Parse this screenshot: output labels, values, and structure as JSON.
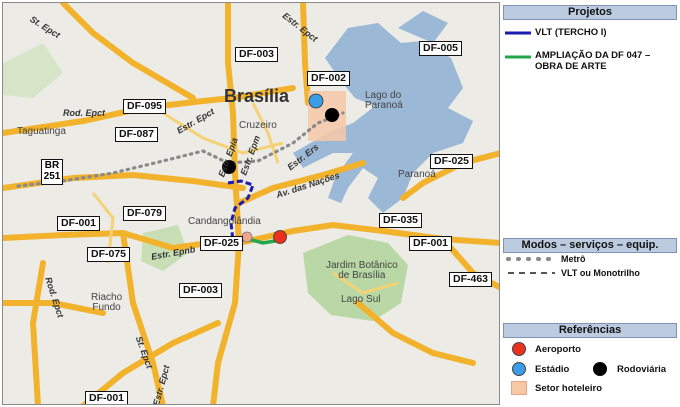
{
  "map": {
    "places": {
      "brasilia": "Brasília",
      "cruzeiro": "Cruzeiro",
      "lago_do_paranoa": "Lago do\nParanoá",
      "paranoa": "Paranoá",
      "taguatinga": "Taguatinga",
      "candangolandia": "Candangolândia",
      "jardim_botanico": "Jardim Botânico\nde Brasília",
      "lago_sul": "Lago Sul",
      "riacho_fundo": "Riacho\nFundo"
    },
    "roads": {
      "st_epct_top": "St. Epct",
      "estr_epct": "Estr. Epct",
      "rod_epct": "Rod. Epct",
      "estr_epct_mid": "Estr. Epct",
      "estr_epia": "Estr. Epia",
      "estr_epm": "Estr. Epm",
      "estr_ers": "Estr. Ers",
      "av_nacoes": "Av. das Nações",
      "estr_epnb": "Estr. Epnb",
      "rod_epct_left": "Rod. Epct",
      "st_epct_bottom": "St. Epct",
      "estr_epct_bottom": "Estr. Epct"
    },
    "shields": {
      "df003_top": "DF-003",
      "df005": "DF-005",
      "df002": "DF-002",
      "df095": "DF-095",
      "df087": "DF-087",
      "df025_right": "DF-025",
      "df079": "DF-079",
      "df001_left": "DF-001",
      "df035": "DF-035",
      "df025_bottom": "DF-025",
      "df001_right": "DF-001",
      "df075": "DF-075",
      "df463": "DF-463",
      "df003_bottom": "DF-003",
      "df001_bottom": "DF-001",
      "br251_top": "BR",
      "br251_bottom": "251"
    }
  },
  "legend": {
    "projetos": {
      "title": "Projetos",
      "vlt_label": "VLT  (TERCHO I)",
      "vlt_color": "#1b1bb0",
      "ampliacao_label": "AMPLIAÇÃO DA DF 047 –\nOBRA DE ARTE",
      "ampliacao_color": "#22a84a"
    },
    "modos": {
      "title": "Modos – serviços – equip.",
      "metro_label": "Metrô",
      "vlt_mono_label": "VLT ou Monotrilho"
    },
    "referencias": {
      "title": "Referências",
      "aeroporto_label": "Aeroporto",
      "aeroporto_color": "#e8321e",
      "estadio_label": "Estádio",
      "estadio_color": "#3b9ce8",
      "rodoviaria_label": "Rodoviária",
      "rodoviaria_color": "#000000",
      "setor_label": "Setor  hoteleiro",
      "setor_color": "#f7c8a6"
    }
  }
}
